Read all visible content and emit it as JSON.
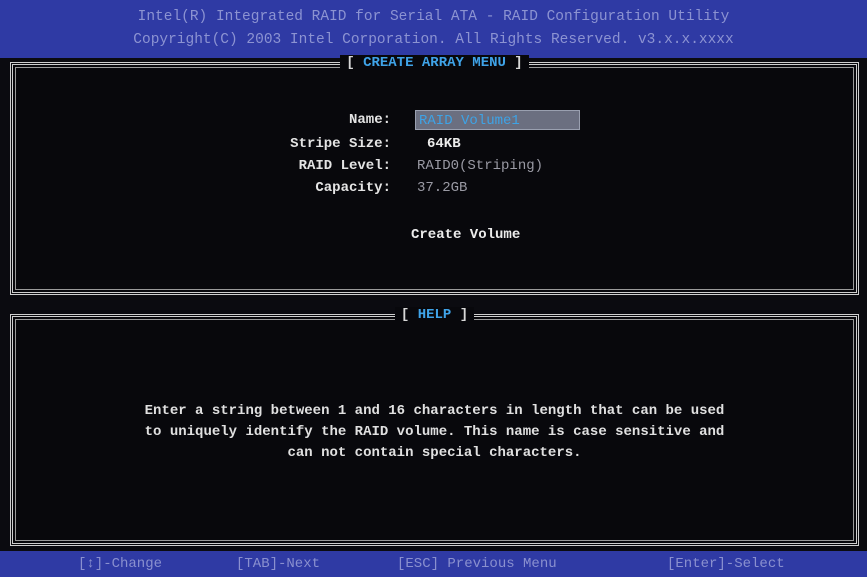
{
  "header": {
    "line1": "Intel(R) Integrated RAID for Serial ATA - RAID Configuration Utility",
    "line2": "Copyright(C) 2003 Intel Corporation. All Rights Reserved. v3.x.x.xxxx"
  },
  "create_panel": {
    "title": "CREATE ARRAY MENU",
    "fields": {
      "name_label": "Name:",
      "name_value": "RAID Volume1",
      "stripe_label": "Stripe Size:",
      "stripe_value": "64KB",
      "level_label": "RAID Level:",
      "level_value": "RAID0(Striping)",
      "capacity_label": "Capacity:",
      "capacity_value": "37.2GB"
    },
    "create_button": "Create Volume"
  },
  "help_panel": {
    "title": "HELP",
    "lines": [
      "Enter a string between 1 and 16 characters in length that can be used",
      "to uniquely identify the RAID volume. This name is case sensitive and",
      "can not contain special characters."
    ]
  },
  "footer": {
    "change": "[↕]-Change",
    "next": "[TAB]-Next",
    "previous": "[ESC] Previous Menu",
    "select": "[Enter]-Select"
  },
  "colors": {
    "header_bg": "#2f3aa4",
    "title_accent": "#3fa3e8",
    "background": "#08080c"
  }
}
